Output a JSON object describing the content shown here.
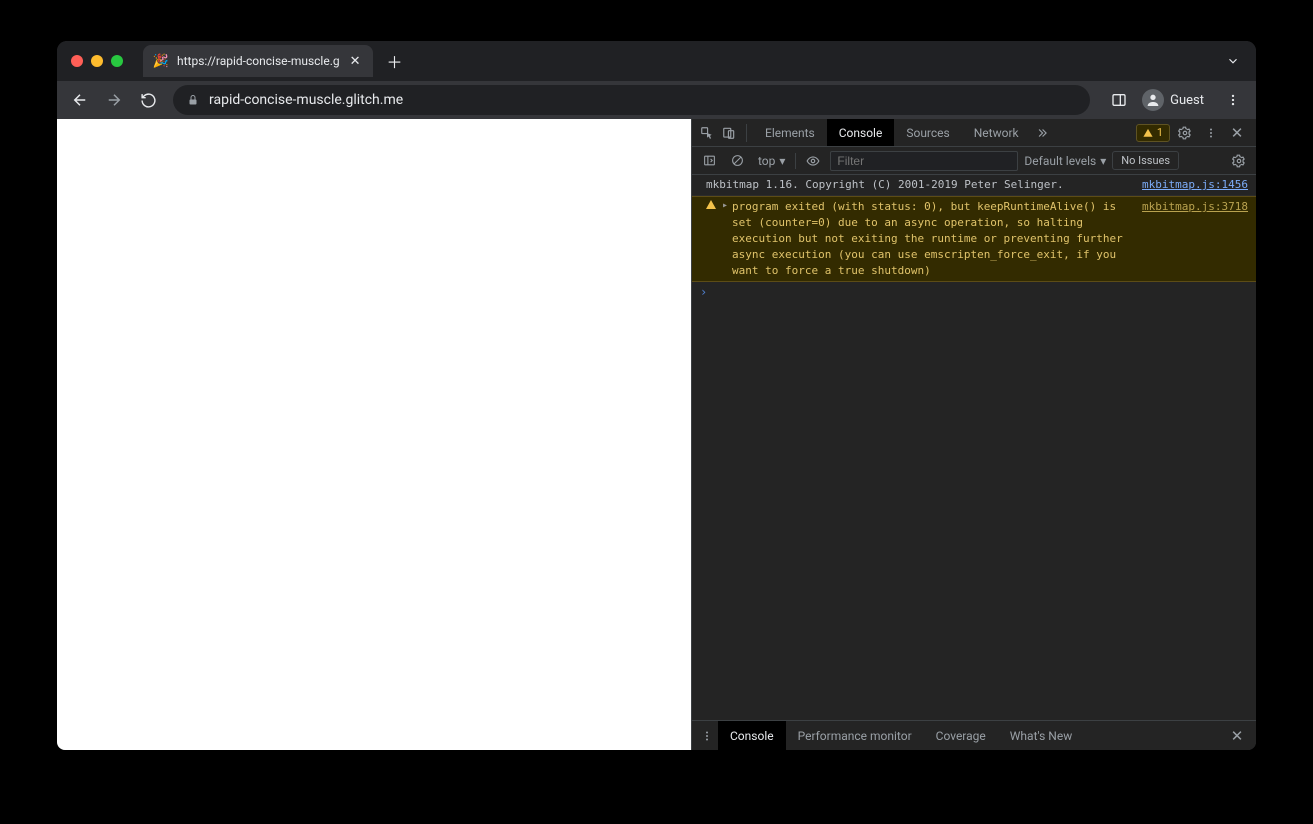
{
  "tab": {
    "title": "https://rapid-concise-muscle.g",
    "favicon": "🎉"
  },
  "toolbar": {
    "url": "rapid-concise-muscle.glitch.me",
    "profile_label": "Guest"
  },
  "devtools": {
    "tabs": {
      "elements": "Elements",
      "console": "Console",
      "sources": "Sources",
      "network": "Network"
    },
    "warn_count": "1",
    "console_toolbar": {
      "context": "top",
      "filter_placeholder": "Filter",
      "levels": "Default levels",
      "issues": "No Issues"
    },
    "logs": {
      "info_msg": "mkbitmap 1.16. Copyright (C) 2001-2019 Peter Selinger.",
      "info_src": "mkbitmap.js:1456",
      "warn_msg": "program exited (with status: 0), but keepRuntimeAlive() is set (counter=0) due to an async operation, so halting execution but not exiting the runtime or preventing further async execution (you can use emscripten_force_exit, if you want to force a true shutdown)",
      "warn_src": "mkbitmap.js:3718"
    },
    "drawer": {
      "console": "Console",
      "perf": "Performance monitor",
      "coverage": "Coverage",
      "whatsnew": "What's New"
    }
  }
}
